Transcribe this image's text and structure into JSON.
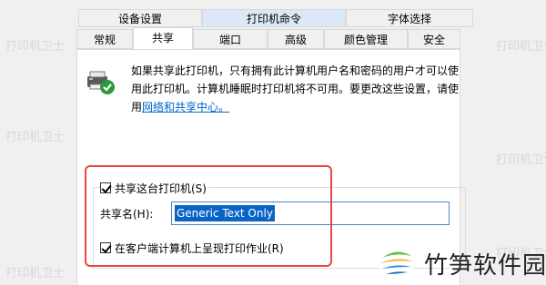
{
  "tabs_row1": [
    {
      "label": "设备设置"
    },
    {
      "label": "打印机命令"
    },
    {
      "label": "字体选择"
    }
  ],
  "tabs_row2": [
    {
      "label": "常规"
    },
    {
      "label": "共享"
    },
    {
      "label": "端口"
    },
    {
      "label": "高级"
    },
    {
      "label": "颜色管理"
    },
    {
      "label": "安全"
    }
  ],
  "selected_tab": "共享",
  "info": {
    "line1": "如果共享此打印机，只有拥有此计算机用户名和密码的用户才可以使",
    "line2": "用此打印机。计算机睡眠时打印机将不可用。要更改这些设置，请使",
    "line3_prefix": "用",
    "link": "网络和共享中心。"
  },
  "share_checkbox": {
    "label": "共享这台打印机(S)",
    "checked": true
  },
  "share_name": {
    "label": "共享名(H):",
    "value": "Generic  Text Only"
  },
  "render_checkbox": {
    "label": "在客户端计算机上呈现打印作业(R)",
    "checked": true
  },
  "watermark": "打印机卫士",
  "brand": {
    "name": "竹笋软件园"
  },
  "colors": {
    "highlight": "#e24a4a",
    "selection": "#0a64c8",
    "link": "#0066cc"
  },
  "icons": {
    "printer": "shared-printer-icon",
    "logo": "bamboo-logo-icon"
  }
}
